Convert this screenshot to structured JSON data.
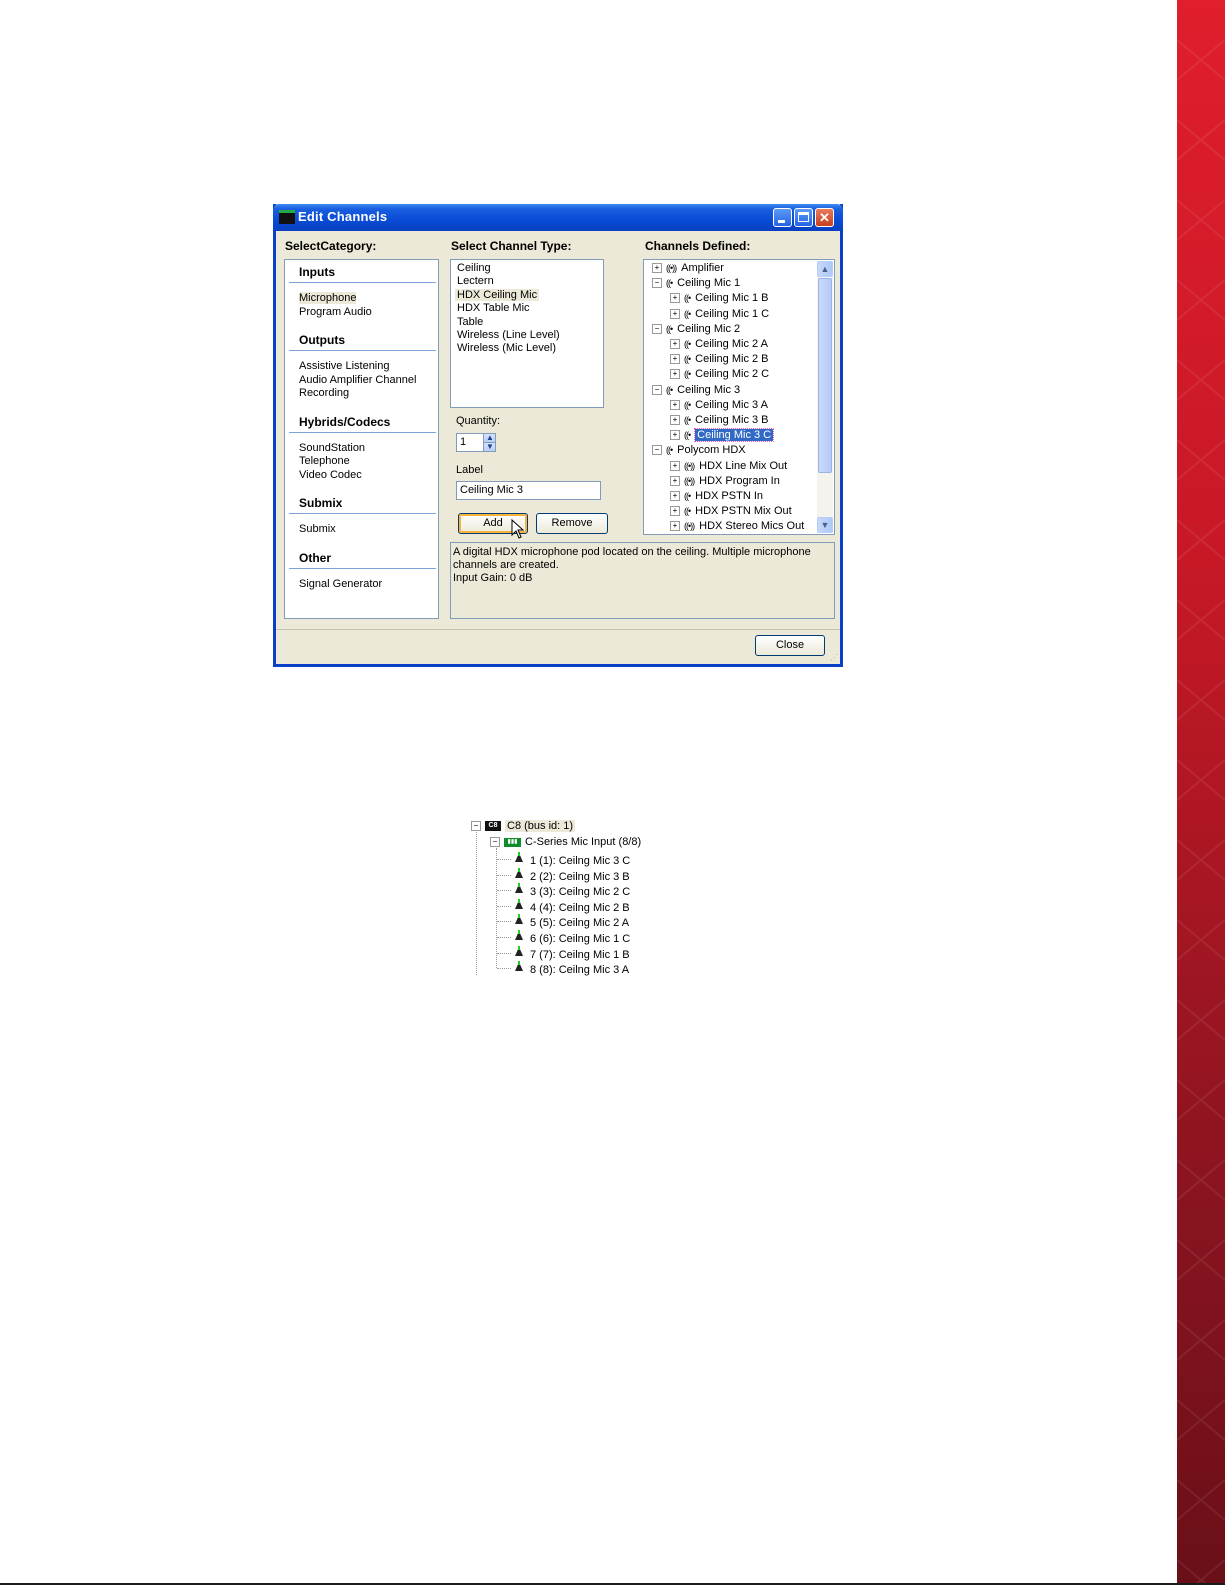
{
  "window": {
    "title": "Edit Channels",
    "headers": {
      "category": "SelectCategory:",
      "channel_type": "Select Channel Type:",
      "channels_defined": "Channels Defined:"
    }
  },
  "categories": [
    {
      "group": "Inputs",
      "items": [
        "Microphone",
        "Program Audio"
      ]
    },
    {
      "group": "Outputs",
      "items": [
        "Assistive Listening",
        "Audio Amplifier Channel",
        "Recording"
      ]
    },
    {
      "group": "Hybrids/Codecs",
      "items": [
        "SoundStation",
        "Telephone",
        "Video Codec"
      ]
    },
    {
      "group": "Submix",
      "items": [
        "Submix"
      ]
    },
    {
      "group": "Other",
      "items": [
        "Signal Generator"
      ]
    }
  ],
  "selected_category": "Microphone",
  "channel_types": [
    "Ceiling",
    "Lectern",
    "HDX Ceiling Mic",
    "HDX Table Mic",
    "Table",
    "Wireless (Line Level)",
    "Wireless (Mic Level)"
  ],
  "selected_channel_type": "HDX Ceiling Mic",
  "quantity": {
    "label": "Quantity:",
    "value": "1"
  },
  "label_field": {
    "label": "Label",
    "value": "Ceiling Mic 3"
  },
  "buttons": {
    "add": "Add",
    "remove": "Remove",
    "close": "Close"
  },
  "channels_defined": [
    {
      "level": 0,
      "exp": "+",
      "sig": "((•))",
      "text": "Amplifier"
    },
    {
      "level": 0,
      "exp": "−",
      "sig": "((•",
      "text": "Ceiling Mic 1"
    },
    {
      "level": 1,
      "exp": "+",
      "sig": "((•",
      "text": "Ceiling Mic 1 B"
    },
    {
      "level": 1,
      "exp": "+",
      "sig": "((•",
      "text": "Ceiling Mic 1 C"
    },
    {
      "level": 0,
      "exp": "−",
      "sig": "((•",
      "text": "Ceiling Mic 2"
    },
    {
      "level": 1,
      "exp": "+",
      "sig": "((•",
      "text": "Ceiling Mic 2 A"
    },
    {
      "level": 1,
      "exp": "+",
      "sig": "((•",
      "text": "Ceiling Mic 2 B"
    },
    {
      "level": 1,
      "exp": "+",
      "sig": "((•",
      "text": "Ceiling Mic 2 C"
    },
    {
      "level": 0,
      "exp": "−",
      "sig": "((•",
      "text": "Ceiling Mic 3"
    },
    {
      "level": 1,
      "exp": "+",
      "sig": "((•",
      "text": "Ceiling Mic 3 A"
    },
    {
      "level": 1,
      "exp": "+",
      "sig": "((•",
      "text": "Ceiling Mic 3 B"
    },
    {
      "level": 1,
      "exp": "+",
      "sig": "((•",
      "text": "Ceiling Mic 3 C",
      "selected": true
    },
    {
      "level": 0,
      "exp": "−",
      "sig": "((•",
      "text": "Polycom HDX"
    },
    {
      "level": 1,
      "exp": "+",
      "sig": "((•))",
      "text": "HDX Line Mix Out"
    },
    {
      "level": 1,
      "exp": "+",
      "sig": "((•))",
      "text": "HDX Program In"
    },
    {
      "level": 1,
      "exp": "+",
      "sig": "((•",
      "text": "HDX PSTN In"
    },
    {
      "level": 1,
      "exp": "+",
      "sig": "((•",
      "text": "HDX PSTN Mix Out"
    },
    {
      "level": 1,
      "exp": "+",
      "sig": "((•))",
      "text": "HDX Stereo Mics Out"
    }
  ],
  "description": [
    "A digital HDX microphone pod located on the ceiling.  Multiple microphone",
    "channels are created.",
    "Input Gain: 0 dB"
  ],
  "device_tree": {
    "root": "C8 (bus id: 1)",
    "root_badge": "C8",
    "group": "C-Series Mic Input (8/8)",
    "channels": [
      "1 (1): Ceilng Mic 3 C",
      "2 (2): Ceilng Mic 3 B",
      "3 (3): Ceilng Mic 2 C",
      "4 (4): Ceilng Mic 2 B",
      "5 (5): Ceilng Mic 2 A",
      "6 (6): Ceilng Mic 1 C",
      "7 (7): Ceilng Mic 1 B",
      "8 (8): Ceilng Mic 3 A"
    ]
  },
  "colors": {
    "titlebar": "#0a4bd6",
    "selection": "#316ac5",
    "red_band": "#d41c2a",
    "dialog_bg": "#ece9d8"
  }
}
